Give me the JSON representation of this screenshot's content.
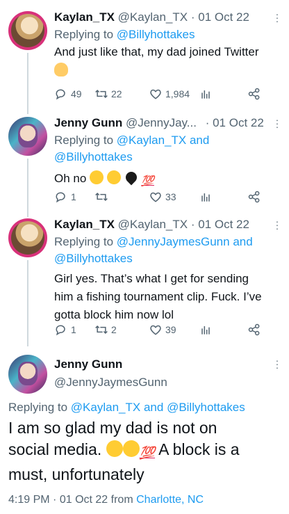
{
  "tweets": [
    {
      "name": "Kaylan_TX",
      "handle": "@Kaylan_TX",
      "sep": "·",
      "date": "01 Oct 22",
      "replying_prefix": "Replying to",
      "replying_to_1": "@Billyhottakes",
      "text": "And just like that, my dad joined Twitter",
      "emoji": [
        "woman-facepalming"
      ],
      "replies": "49",
      "retweets": "22",
      "likes": "1,984"
    },
    {
      "name": "Jenny Gunn",
      "handle": "@JennyJay...",
      "sep": "·",
      "date": "01 Oct 22",
      "replying_prefix": "Replying to",
      "replying_to_1": "@Kaylan_TX",
      "replying_and": "and",
      "replying_to_2": "@Billyhottakes",
      "text": "Oh no",
      "emoji": [
        "grinning-squinting",
        "rolling-on-floor-laughing",
        "black-heart"
      ],
      "emoji_100": "💯",
      "replies": "1",
      "retweets": "",
      "likes": "33"
    },
    {
      "name": "Kaylan_TX",
      "handle": "@Kaylan_TX",
      "sep": "·",
      "date": "01 Oct 22",
      "replying_prefix": "Replying to",
      "replying_to_1": "@JennyJaymesGunn",
      "replying_and": "and",
      "replying_to_2": "@Billyhottakes",
      "text_line1": "Girl yes. That’s what I get for sending",
      "text_line2": "him a fishing tournament clip. Fuck. I’ve",
      "text_line3": "gotta block him now lol",
      "replies": "1",
      "retweets": "2",
      "likes": "39"
    }
  ],
  "focused": {
    "name": "Jenny Gunn",
    "handle": "@JennyJaymesGunn",
    "replying_prefix": "Replying to",
    "replying_to_1": "@Kaylan_TX",
    "replying_and": "and",
    "replying_to_2": "@Billyhottakes",
    "text_line1": "I am so glad my dad is not on",
    "text_line2a": "social media.",
    "emoji_100": "💯",
    "text_line2b": "A block is a",
    "text_line3": "must, unfortunately",
    "time": "4:19 PM",
    "sep": "·",
    "date": "01 Oct 22",
    "from": "from",
    "location": "Charlotte, NC"
  },
  "colors": {
    "link": "#1d9bf0",
    "muted": "#536471",
    "text": "#0f1419",
    "thread": "#cfd9de"
  }
}
